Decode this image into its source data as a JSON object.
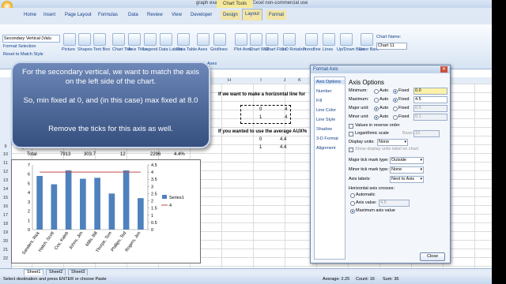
{
  "window": {
    "title": "graph example - Microsoft Excel non-commercial use",
    "context_tab": "Chart Tools"
  },
  "tabs": [
    {
      "label": "Home"
    },
    {
      "label": "Insert"
    },
    {
      "label": "Page Layout"
    },
    {
      "label": "Formulas"
    },
    {
      "label": "Data"
    },
    {
      "label": "Review"
    },
    {
      "label": "View"
    },
    {
      "label": "Developer"
    },
    {
      "label": "Design"
    },
    {
      "label": "Layout"
    },
    {
      "label": "Format"
    }
  ],
  "ribbon": {
    "selection_box": "Secondary Vertical (Valu",
    "format_selection": "Format Selection",
    "reset_style": "Reset to Match Style",
    "buttons": [
      "Picture",
      "Shapes",
      "Text Box",
      "Chart Title",
      "Axis Titles",
      "Legend",
      "Data Labels",
      "Data Table",
      "Axes",
      "Gridlines",
      "Plot Area",
      "Chart Wall",
      "Chart Floor",
      "3-D Rotation",
      "Trendline",
      "Lines",
      "Up/Down Bars",
      "Error Bars"
    ],
    "group_axes": "Axes",
    "chart_name_label": "Chart Name:",
    "chart_name_value": "Chart 11"
  },
  "columns": [
    "H",
    "I",
    "J",
    "K"
  ],
  "rows": [
    "9",
    "10",
    "11",
    "12",
    "13",
    "14",
    "15",
    "16",
    "17",
    "18",
    "19",
    "20",
    "21",
    "22",
    "23"
  ],
  "table": {
    "row9": [
      "Rogers, Jen",
      "1057",
      "278.9",
      "29",
      "255",
      "3.4%"
    ],
    "row10": [
      "Total",
      "7913",
      "303.7",
      "12",
      "2296",
      "4.4%"
    ]
  },
  "sheet_text": {
    "line_question": "If we want to make a horizontal line for",
    "average_question": "If you wanted to use the average AUX%",
    "v_0": "0",
    "v_4a": "4",
    "v_1": "1",
    "v_4b": "4",
    "v_0b": "0",
    "v_44a": "4.4",
    "v_1b": "1",
    "v_44b": "4.4"
  },
  "callout": {
    "p1": "For the secondary vertical, we want to match the axis on the left side of the chart.",
    "p2": "So, min fixed at 0, and (in this case) max fixed at 8.0",
    "p3": "Remove the ticks for this axis as well."
  },
  "chart_data": {
    "type": "bar",
    "categories": [
      "Sanders, Rick",
      "Hatch, Scott",
      "Cox, Kaleb",
      "Johns, Jim",
      "Mills, Bill",
      "Thorpe, Tom",
      "Phillips, Ted",
      "Rogers, Jen"
    ],
    "series": [
      {
        "name": "Series1",
        "values": [
          5.8,
          4.9,
          6.4,
          5.5,
          5.6,
          3.9,
          6.4,
          3.4
        ]
      },
      {
        "name": "4",
        "values": [
          4,
          4,
          4,
          4,
          4,
          4,
          4,
          4
        ]
      }
    ],
    "ylim_left": [
      0,
      7
    ],
    "left_ticks": [
      "0",
      "1",
      "2",
      "3",
      "4",
      "5",
      "6",
      "7"
    ],
    "ylim_right": [
      0,
      4.5
    ],
    "right_ticks": [
      "0",
      "0.5",
      "1",
      "1.5",
      "2",
      "2.5",
      "3",
      "3.5",
      "4",
      "4.5"
    ],
    "colors": {
      "bar": "#4f81bd",
      "line": "#c0504d"
    },
    "legend_placement": "right"
  },
  "dialog": {
    "title": "Format Axis",
    "nav": [
      "Axis Options",
      "Number",
      "Fill",
      "Line Color",
      "Line Style",
      "Shadow",
      "3-D Format",
      "Alignment"
    ],
    "heading": "Axis Options",
    "min_label": "Minimum:",
    "max_label": "Maximum:",
    "major_label": "Major unit:",
    "minor_label": "Minor unit:",
    "auto": "Auto",
    "fixed": "Fixed",
    "min_value": "0.0",
    "max_value": "4.5",
    "major_value": "0.5",
    "minor_value": "0.1",
    "reverse": "Values in reverse order",
    "log": "Logarithmic scale",
    "base": "Base:",
    "base_value": "10",
    "display_units": "Display units:",
    "display_units_value": "None",
    "show_units": "Show display units label on chart",
    "major_tick": "Major tick mark type:",
    "major_tick_value": "Outside",
    "minor_tick": "Minor tick mark type:",
    "minor_tick_value": "None",
    "axis_labels": "Axis labels:",
    "axis_labels_value": "Next to Axis",
    "h_crosses": "Horizontal axis crosses:",
    "automatic": "Automatic",
    "axis_value": "Axis value:",
    "axis_value_num": "4.5",
    "max_axis": "Maximum axis value",
    "close": "Close"
  },
  "sheets": [
    "Sheet1",
    "Sheet2",
    "Sheet3"
  ],
  "status": {
    "text": "Select destination and press ENTER or choose Paste",
    "average": "Average: 2.25",
    "count": "Count: 16",
    "sum": "Sum: 36"
  }
}
